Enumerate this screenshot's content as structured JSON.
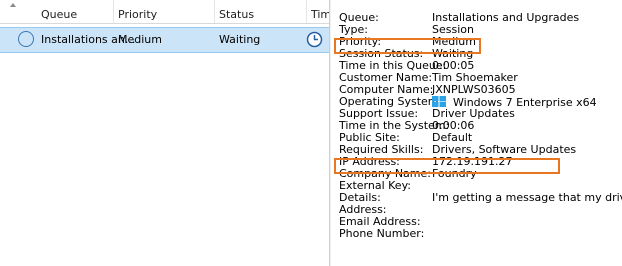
{
  "queue_list": {
    "columns": [
      "Queue",
      "Priority",
      "Status",
      "Tim"
    ],
    "row": {
      "queue": "Installations an...",
      "priority": "Medium",
      "status": "Waiting"
    }
  },
  "details": {
    "fields": [
      {
        "label": "Queue:",
        "value": "Installations and Upgrades"
      },
      {
        "label": "Type:",
        "value": "Session"
      },
      {
        "label": "Priority:",
        "value": "Medium"
      },
      {
        "label": "Session Status:",
        "value": "Waiting"
      },
      {
        "label": "Time in this Queue:",
        "value": "0:00:05"
      },
      {
        "label": "Customer Name:",
        "value": "Tim Shoemaker"
      },
      {
        "label": "Computer Name:",
        "value": "JXNPLWS03605"
      },
      {
        "label": "Operating System:",
        "value": "Windows 7 Enterprise x64",
        "icon": "windows-icon"
      },
      {
        "label": "Support Issue:",
        "value": "Driver Updates"
      },
      {
        "label": "Time in the System:",
        "value": "0:00:06"
      },
      {
        "label": "Public Site:",
        "value": "Default"
      },
      {
        "label": "Required Skills:",
        "value": "Drivers, Software Updates"
      },
      {
        "label": "IP Address:",
        "value": "172.19.191.27"
      },
      {
        "label": "Company Name:",
        "value": "Foundry"
      },
      {
        "label": "External Key:",
        "value": ""
      },
      {
        "label": "Details:",
        "value": "I'm getting a message that my drive..."
      },
      {
        "label": "Address:",
        "value": ""
      },
      {
        "label": "Email Address:",
        "value": ""
      },
      {
        "label": "Phone Number:",
        "value": ""
      }
    ],
    "highlighted_fields": [
      "Priority:",
      "Required Skills:"
    ]
  },
  "colors": {
    "selection": "#cce4f7",
    "highlight_box": "#e87722",
    "status_circle": "#3d76b6",
    "windows_logo": "#2aa3e8"
  }
}
